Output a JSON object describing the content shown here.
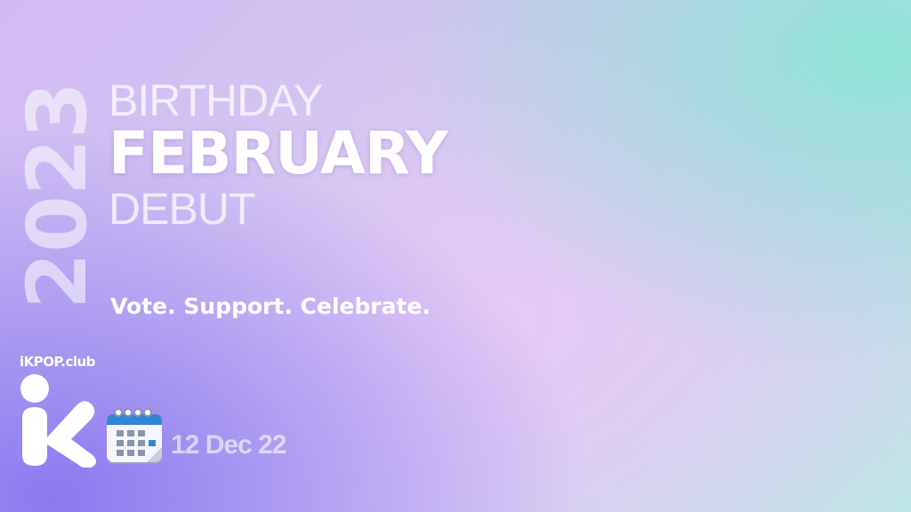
{
  "year": "2023",
  "label_top": "BIRTHDAY",
  "month": "FEBRUARY",
  "label_bottom": "DEBUT",
  "tagline": "Vote. Support. Celebrate.",
  "brand": "iKPOP.club",
  "logo_icon": "ikpop-k-logo-icon",
  "calendar_icon": "calendar-icon",
  "date": "12 Dec 22",
  "colors": {
    "teal": "#8fe3d8",
    "lavender": "#e6c9f6",
    "violet": "#8b79f0",
    "text": "#ffffff"
  }
}
